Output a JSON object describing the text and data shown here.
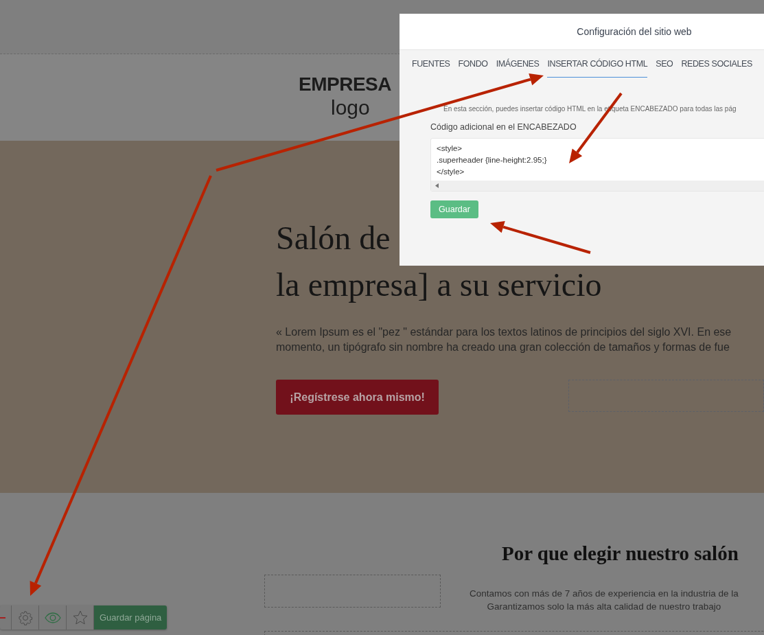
{
  "header": {
    "logo_title": "EMPRESA",
    "logo_subtitle": "logo"
  },
  "hero": {
    "title_lines": [
      "Salón de",
      "la empresa] a su servicio"
    ],
    "text_lines": [
      "« Lorem Ipsum es el \"pez \" estándar para los textos latinos de principios del siglo XVI. En ese",
      "momento, un tipógrafo sin nombre ha creado una gran colección de tamaños y formas de fue"
    ],
    "cta": "¡Regístrese ahora mismo!"
  },
  "features": {
    "heading": "Por que elegir nuestro salón",
    "text_lines": [
      "Contamos con más de 7 años de experiencia en la industria de la",
      "Garantizamos solo la más alta calidad de nuestro trabajo"
    ]
  },
  "toolbar": {
    "items": [
      {
        "kind": "dash"
      },
      {
        "kind": "gear"
      },
      {
        "kind": "eye"
      },
      {
        "kind": "star"
      }
    ],
    "save_button": "Guardar página"
  },
  "dialog": {
    "title": "Configuración del sitio web",
    "tabs": [
      {
        "label": "FUENTES",
        "selected": false
      },
      {
        "label": "FONDO",
        "selected": false
      },
      {
        "label": "IMÁGENES",
        "selected": false
      },
      {
        "label": "INSERTAR CÓDIGO HTML",
        "selected": true
      },
      {
        "label": "SEO",
        "selected": false
      },
      {
        "label": "REDES SOCIALES",
        "selected": false
      }
    ],
    "description": "En esta sección, puedes insertar código HTML en la etiqueta ENCABEZADO para todas las pág",
    "field_label": "Código adicional en el ENCABEZADO",
    "code_lines": [
      "<style>",
      ".superheader {line-height:2.95;}",
      "</style>"
    ],
    "save_button": "Guardar"
  }
}
